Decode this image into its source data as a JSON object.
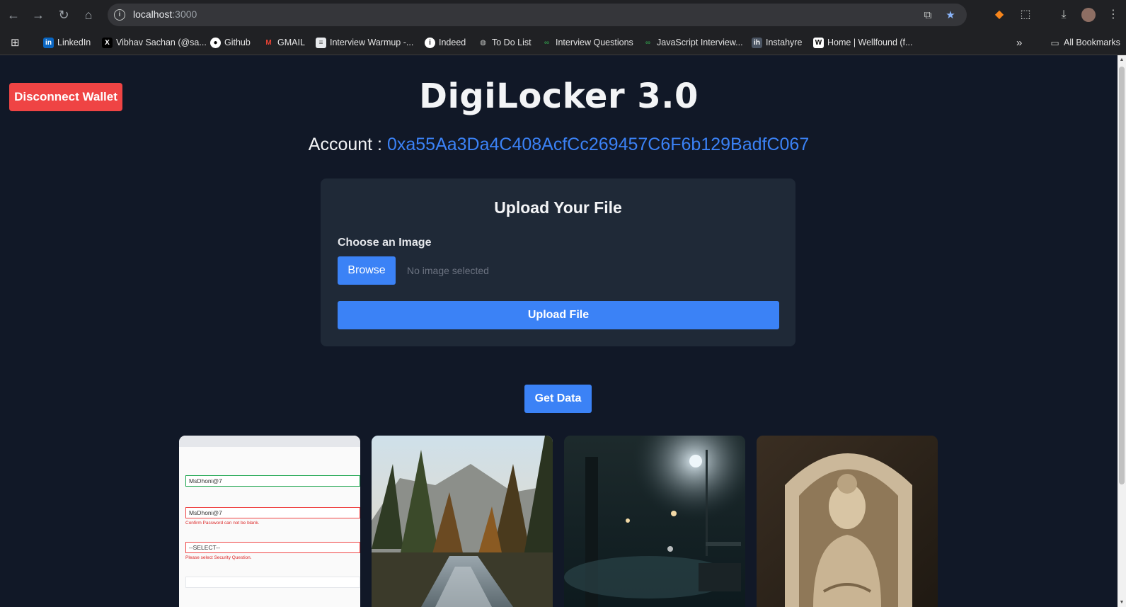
{
  "browser": {
    "url_host": "localhost",
    "url_port": ":3000",
    "bookmarks": [
      {
        "label": "LinkedIn",
        "icon": "linkedin-icon"
      },
      {
        "label": "Vibhav Sachan (@sa...",
        "icon": "x-icon"
      },
      {
        "label": "Github",
        "icon": "github-icon"
      },
      {
        "label": "GMAIL",
        "icon": "gmail-icon"
      },
      {
        "label": "Interview Warmup -...",
        "icon": "doc-icon"
      },
      {
        "label": "Indeed",
        "icon": "info-icon"
      },
      {
        "label": "To Do List",
        "icon": "globe-icon"
      },
      {
        "label": "Interview Questions",
        "icon": "gfg-icon"
      },
      {
        "label": "JavaScript Interview...",
        "icon": "gfg-icon"
      },
      {
        "label": "Instahyre",
        "icon": "instahyre-icon"
      },
      {
        "label": "Home | Wellfound (f...",
        "icon": "wellfound-icon"
      }
    ],
    "all_bookmarks_label": "All Bookmarks"
  },
  "app": {
    "disconnect_label": "Disconnect Wallet",
    "title": "DigiLocker 3.0",
    "account_label": "Account :",
    "account_address": "0xa55Aa3Da4C408AcfCc269457C6F6b129BadfC067",
    "upload_card": {
      "heading": "Upload Your File",
      "choose_label": "Choose an Image",
      "browse_label": "Browse",
      "no_file_text": "No image selected",
      "upload_label": "Upload File"
    },
    "get_data_label": "Get Data",
    "gallery": {
      "form_shot": {
        "field1": "MsDhoni@7",
        "field2": "MsDhoni@7",
        "error2": "Confirm Password can not be blank.",
        "select": "--SELECT--",
        "error3": "Please select Security Question."
      }
    }
  },
  "colors": {
    "background": "#111827",
    "card": "#1f2937",
    "primary": "#3b82f6",
    "danger": "#ef4444"
  }
}
